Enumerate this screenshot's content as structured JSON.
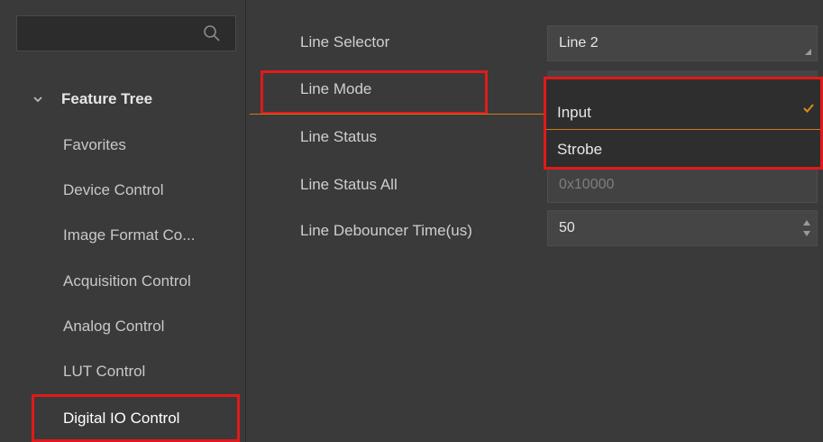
{
  "search": {
    "placeholder": ""
  },
  "sidebar": {
    "header": "Feature Tree",
    "items": [
      {
        "label": "Favorites"
      },
      {
        "label": "Device Control"
      },
      {
        "label": "Image Format Co..."
      },
      {
        "label": "Acquisition Control"
      },
      {
        "label": "Analog Control"
      },
      {
        "label": "LUT Control"
      },
      {
        "label": "Digital IO Control"
      }
    ]
  },
  "properties": {
    "line_selector": {
      "label": "Line Selector",
      "value": "Line 2"
    },
    "line_mode": {
      "label": "Line Mode",
      "value": "Input"
    },
    "line_status": {
      "label": "Line Status"
    },
    "line_status_all": {
      "label": "Line Status All",
      "value": "0x10000"
    },
    "line_debouncer": {
      "label": "Line Debouncer Time(us)",
      "value": "50"
    }
  },
  "dropdown": {
    "options": [
      {
        "label": "Input",
        "selected": true
      },
      {
        "label": "Strobe",
        "selected": false
      }
    ]
  },
  "colors": {
    "highlight": "#e01a1a",
    "accent": "#d07a19",
    "background": "#3a3a3a"
  }
}
